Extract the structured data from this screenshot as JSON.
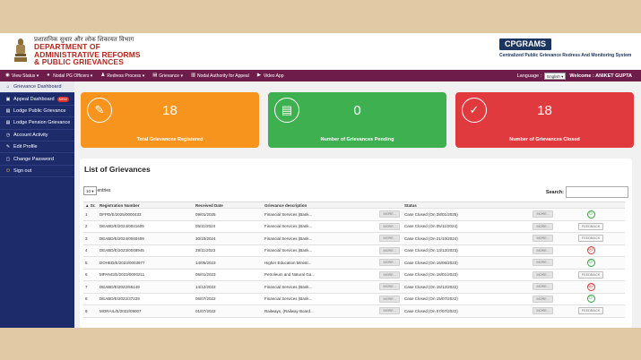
{
  "header": {
    "dept_hindi": "प्रशासनिक सुधार और लोक शिकायत विभाग",
    "dept_line1": "DEPARTMENT OF",
    "dept_line2": "ADMINISTRATIVE REFORMS",
    "dept_line3": "& PUBLIC GRIEVANCES",
    "brand": "CPGRAMS",
    "brand_sub": "Centralized Public Grievance Redress And Monitoring System"
  },
  "nav": {
    "items": [
      {
        "icon": "eye-icon",
        "label": "View Status ▾"
      },
      {
        "icon": "user-icon",
        "label": "Nodal PG Officers ▾"
      },
      {
        "icon": "people-icon",
        "label": "Redress Process ▾"
      },
      {
        "icon": "document-icon",
        "label": "Grievance ▾"
      },
      {
        "icon": "clipboard-icon",
        "label": "Nodal Authority for Appeal"
      },
      {
        "icon": "video-icon",
        "label": "Video App"
      }
    ],
    "language_label": "Language :",
    "language_value": "English ▾",
    "welcome": "Welcome : ANIKET GUPTA"
  },
  "sidebar": {
    "items": [
      {
        "icon": "home-icon",
        "label": "Grievance Dashboard",
        "active": true
      },
      {
        "icon": "appeal-icon",
        "label": "Appeal Dashboard",
        "badge": "NEW"
      },
      {
        "icon": "form-icon",
        "label": "Lodge Public Grievance"
      },
      {
        "icon": "form-icon",
        "label": "Lodge Pension Grievance"
      },
      {
        "icon": "activity-icon",
        "label": "Account Activity"
      },
      {
        "icon": "edit-icon",
        "label": "Edit Profile"
      },
      {
        "icon": "lock-icon",
        "label": "Change Password"
      },
      {
        "icon": "power-icon",
        "label": "Sign out"
      }
    ]
  },
  "cards": [
    {
      "value": "18",
      "label": "Total Grievances Registered",
      "color": "#f7941d",
      "icon": "edit-document-icon"
    },
    {
      "value": "0",
      "label": "Number of Grievances Pending",
      "color": "#3fb04f",
      "icon": "document-list-icon"
    },
    {
      "value": "18",
      "label": "Number of Grievances Closed",
      "color": "#e03a3e",
      "icon": "check-circle-icon"
    }
  ],
  "list": {
    "title": "List of Grievances",
    "page_size": "10 ▾",
    "entries_label": "entries",
    "search_label": "Search:",
    "columns": [
      "Sr.",
      "Registration Number",
      "Received Date",
      "Grievance description",
      "Status",
      ""
    ],
    "more_label": "MORE...",
    "feedback_label": "FEEDBACK",
    "rows": [
      {
        "sr": "1",
        "reg": "DFPD/E/2025/0000433",
        "date": "09/01/2025",
        "desc": "Financial Services (Bank...",
        "status": "Case Closed (On 28/01/2025)",
        "fb": "smile"
      },
      {
        "sr": "2",
        "reg": "DEABD/E/2024/0041605",
        "date": "05/11/2024",
        "desc": "Financial Services (Bank...",
        "status": "Case Closed (On 05/11/2024)",
        "fb": "button"
      },
      {
        "sr": "3",
        "reg": "DEABD/E/2024/0040409",
        "date": "30/10/2024",
        "desc": "Financial Services (Bank...",
        "status": "Case Closed (On 21/10/2024)",
        "fb": "button"
      },
      {
        "sr": "4",
        "reg": "DEABD/E/2023/0048945",
        "date": "28/11/2023",
        "desc": "Financial Services (Bank...",
        "status": "Case Closed (On 13/12/2023)",
        "fb": "sad"
      },
      {
        "sr": "5",
        "reg": "DOHED/E/2023/0003977",
        "date": "14/05/2023",
        "desc": "Higher Education Ministr...",
        "status": "Case Closed (On 16/06/2023)",
        "fb": "smile"
      },
      {
        "sr": "6",
        "reg": "MPANG/E/2023/0000211",
        "date": "06/01/2023",
        "desc": "Petroleum and Natural Ga...",
        "status": "Case Closed (On 18/01/2023)",
        "fb": "button"
      },
      {
        "sr": "7",
        "reg": "DEABD/E/2022/55149",
        "date": "14/12/2022",
        "desc": "Financial Services (Bank...",
        "status": "Case Closed (On 15/12/2022)",
        "fb": "sad"
      },
      {
        "sr": "8",
        "reg": "DEABD/E/2022/37229",
        "date": "06/07/2022",
        "desc": "Financial Services (Bank...",
        "status": "Case Closed (On 15/07/2022)",
        "fb": "smile"
      },
      {
        "sr": "9",
        "reg": "MORAIL/E/2022/09007",
        "date": "01/07/2022",
        "desc": "Railways, (Railway Board...",
        "status": "Case Closed (On 07/07/2022)",
        "fb": "button"
      }
    ]
  }
}
